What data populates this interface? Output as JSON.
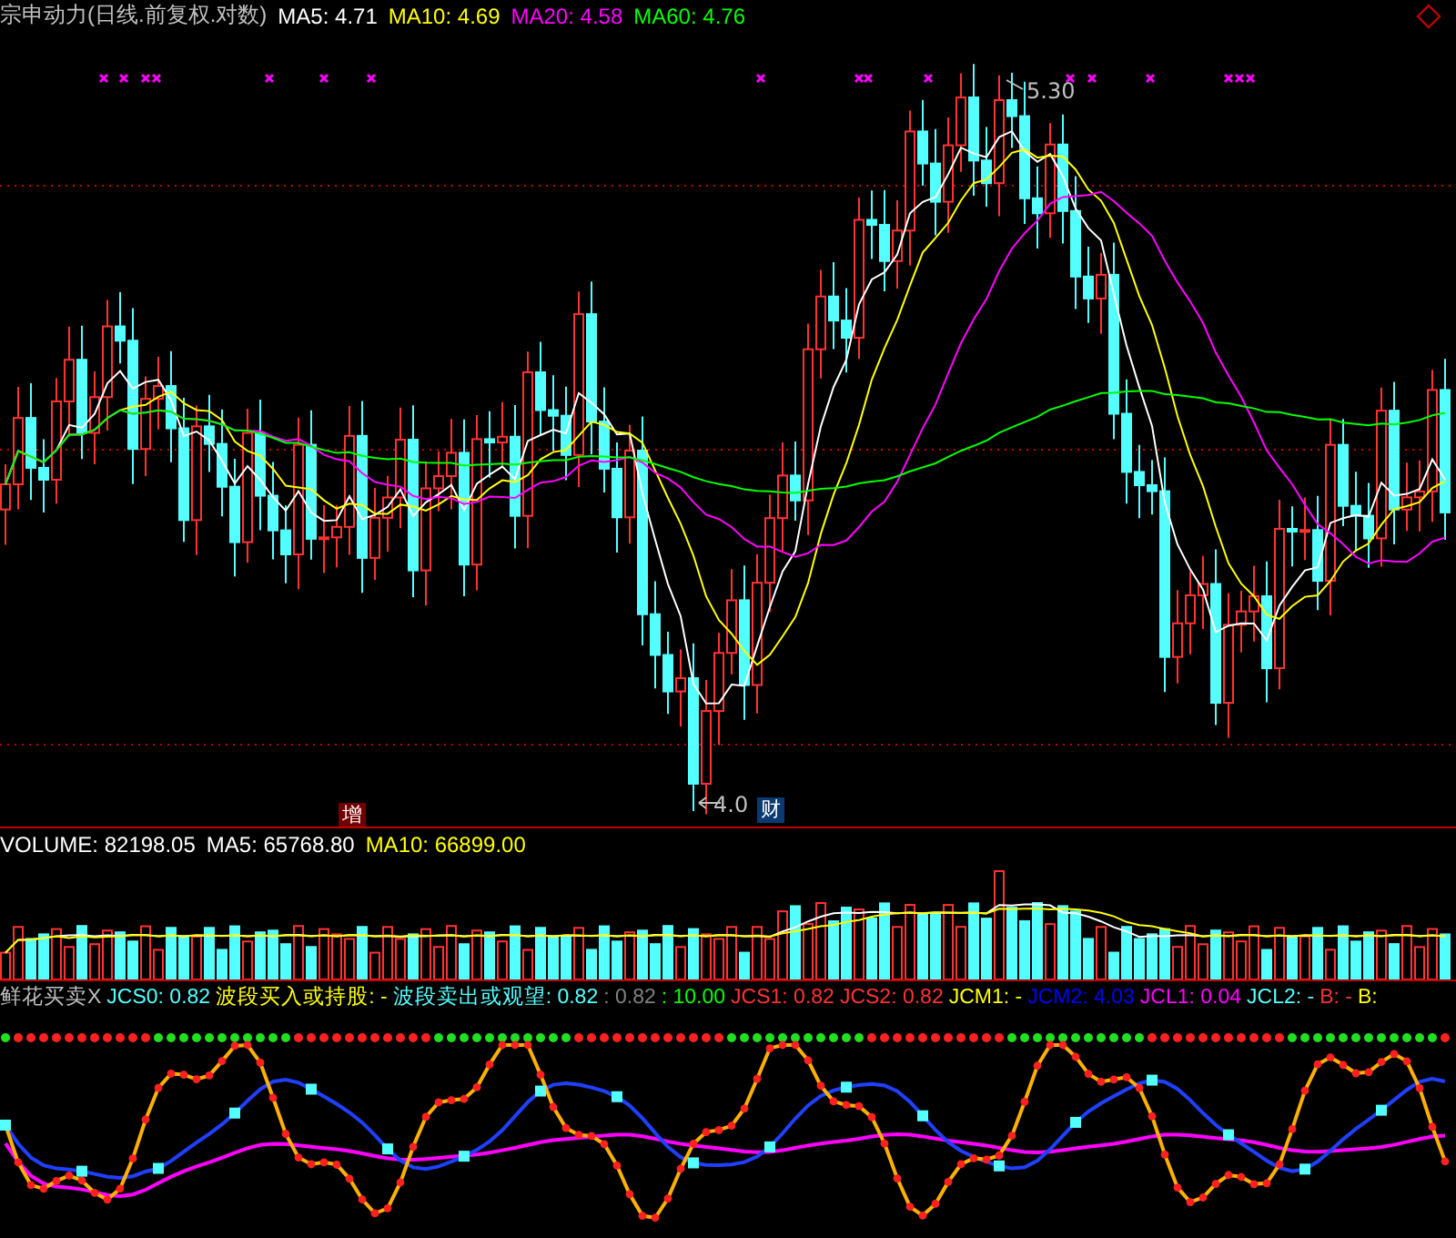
{
  "header": {
    "items": [
      {
        "text": "宗申动力(日线.前复权.对数)",
        "color": "#c0c0c0"
      },
      {
        "text": "MA5: 4.71",
        "color": "#ffffff"
      },
      {
        "text": "MA10: 4.69",
        "color": "#ffff00"
      },
      {
        "text": "MA20: 4.58",
        "color": "#ff00ff"
      },
      {
        "text": "MA60: 4.76",
        "color": "#00ff00"
      }
    ]
  },
  "price_chart": {
    "high_label": "5.30",
    "low_label": "4.0",
    "badges": [
      {
        "text": "增",
        "kind": "increase"
      },
      {
        "text": "财",
        "kind": "finance"
      }
    ]
  },
  "volume": {
    "items": [
      {
        "text": "VOLUME: 82198.05",
        "color": "#ffffff"
      },
      {
        "text": "MA5: 65768.80",
        "color": "#ffffff"
      },
      {
        "text": "MA10: 66899.00",
        "color": "#ffff00"
      }
    ]
  },
  "indicator": {
    "items": [
      {
        "text": "鲜花买卖X",
        "color": "#c0c0c0"
      },
      {
        "text": "JCS0: 0.82",
        "color": "#54ffff"
      },
      {
        "text": "波段买入或持股: -",
        "color": "#ffff00"
      },
      {
        "text": "波段卖出或观望: 0.82",
        "color": "#54ffff"
      },
      {
        "text": ": 0.82",
        "color": "#808080"
      },
      {
        "text": ": 10.00",
        "color": "#00ff00"
      },
      {
        "text": "JCS1: 0.82",
        "color": "#ff3232"
      },
      {
        "text": "JCS2: 0.82",
        "color": "#ff3232"
      },
      {
        "text": "JCM1: -",
        "color": "#ffff00"
      },
      {
        "text": "JCM2: 4.03",
        "color": "#0000ff"
      },
      {
        "text": "JCL1: 0.04",
        "color": "#ff00ff"
      },
      {
        "text": "JCL2: -",
        "color": "#54ffff"
      },
      {
        "text": "B: -",
        "color": "#ff3232"
      },
      {
        "text": "B:",
        "color": "#ffff00"
      }
    ]
  }
}
